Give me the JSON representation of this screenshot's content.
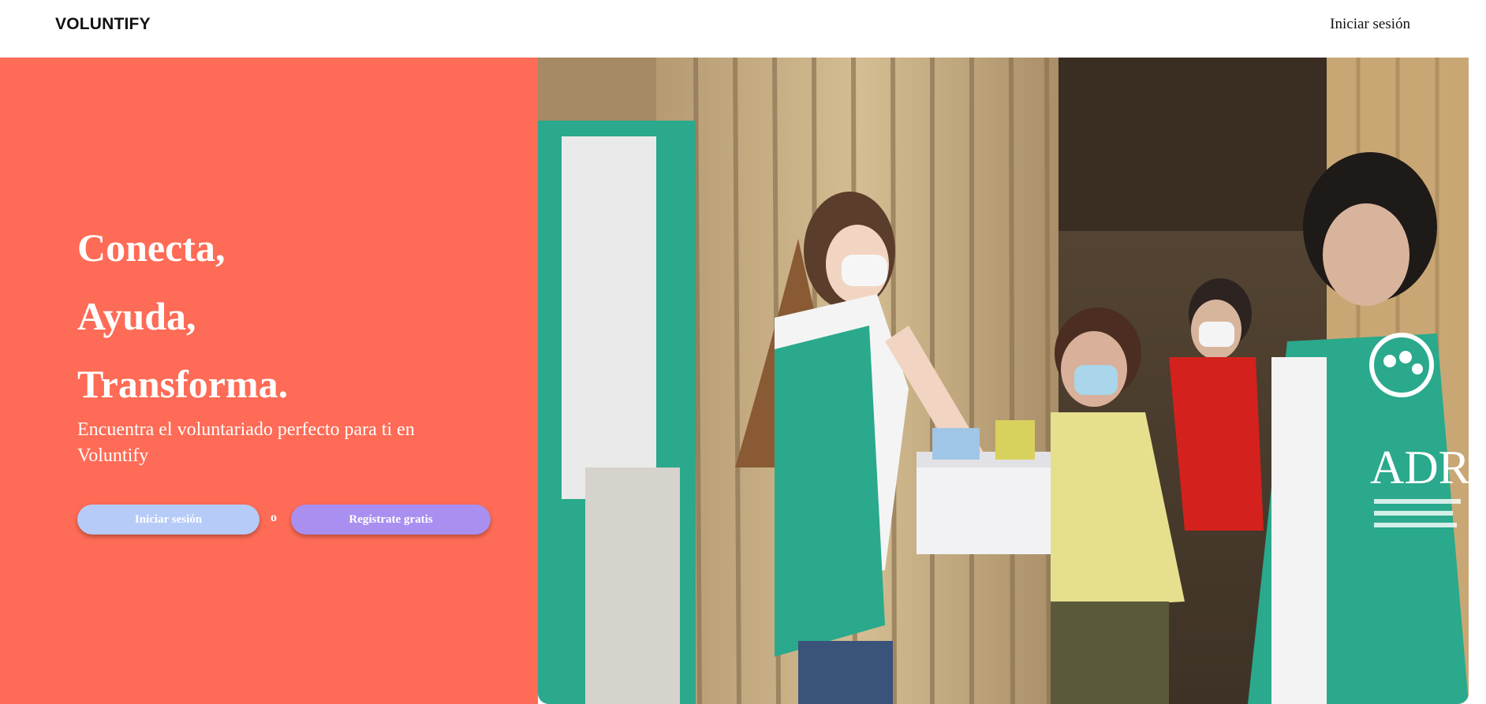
{
  "header": {
    "brand": "VOLUNTIFY",
    "login_link": "Iniciar sesión"
  },
  "hero": {
    "headline_1": "Conecta,",
    "headline_2": "Ayuda,",
    "headline_3": "Transforma.",
    "subtitle": "Encuentra el voluntariado perfecto para ti en Voluntify",
    "login_button": "Iniciar sesión",
    "separator": "o",
    "register_button": "Regístrate gratis"
  },
  "photo": {
    "vest_text": "ADRA"
  },
  "colors": {
    "hero_bg": "#fe6b56",
    "login_button": "#b6cbf7",
    "register_button": "#a98ff0",
    "vest_green": "#2aa98c"
  }
}
